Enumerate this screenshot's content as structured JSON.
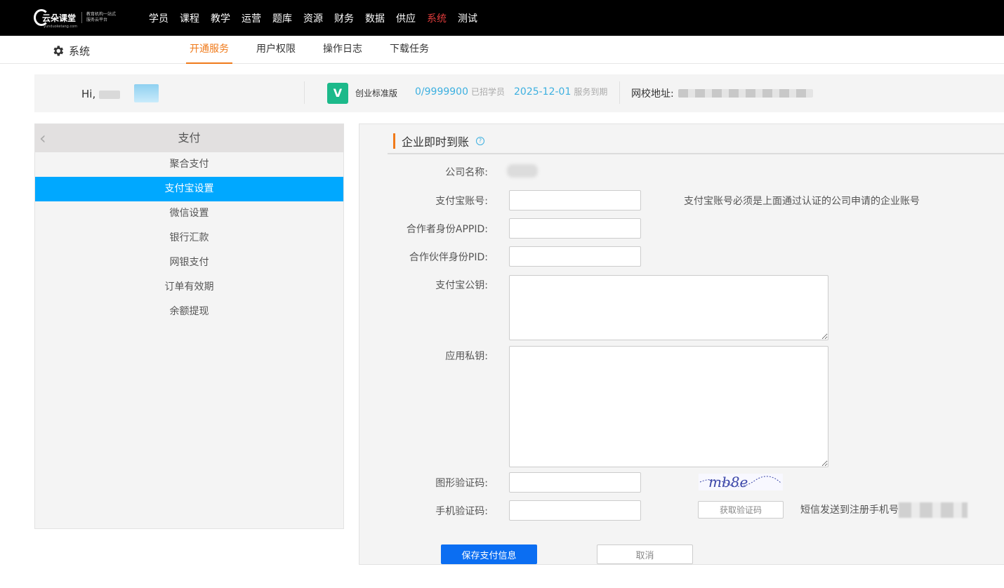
{
  "topbar": {
    "logo": {
      "name": "云朵课堂",
      "domain": "yunduoketang.com",
      "slogan": "教育机构一站式服务云平台"
    },
    "nav": [
      "学员",
      "课程",
      "教学",
      "运营",
      "题库",
      "资源",
      "财务",
      "数据",
      "供应",
      "系统",
      "测试"
    ],
    "active_nav": "系统"
  },
  "subbar": {
    "title": "系统",
    "tabs": [
      "开通服务",
      "用户权限",
      "操作日志",
      "下载任务"
    ],
    "active_tab": "开通服务"
  },
  "infobar": {
    "greeting": "Hi,",
    "version_badge": "V",
    "version_name": "创业标准版",
    "student_count": "0/9999900",
    "student_label": "已招学员",
    "expire_date": "2025-12-01",
    "expire_label": "服务到期",
    "school_label": "网校地址:"
  },
  "sidebar": {
    "title": "支付",
    "items": [
      "聚合支付",
      "支付宝设置",
      "微信设置",
      "银行汇款",
      "网银支付",
      "订单有效期",
      "余额提现"
    ],
    "active_item": "支付宝设置"
  },
  "form": {
    "section_title": "企业即时到账",
    "labels": {
      "company": "公司名称:",
      "alipay_account": "支付宝账号:",
      "appid": "合作者身份APPID:",
      "pid": "合作伙伴身份PID:",
      "public_key": "支付宝公钥:",
      "private_key": "应用私钥:",
      "captcha": "图形验证码:",
      "sms": "手机验证码:"
    },
    "values": {
      "alipay_account": "",
      "appid": "",
      "pid": "",
      "public_key": "",
      "private_key": "",
      "captcha": "",
      "sms": ""
    },
    "account_hint": "支付宝账号必须是上面通过认证的公司申请的企业账号",
    "captcha_image_text": "mb8e",
    "get_code_button": "获取验证码",
    "sms_hint": "短信发送到注册手机号",
    "save_button": "保存支付信息",
    "cancel_button": "取消"
  },
  "colors": {
    "topbar_bg": "#000000",
    "active_nav": "#e03c3c",
    "active_tab": "#f07a1a",
    "sidebar_active": "#00a8ff",
    "primary_button": "#0b6ef2",
    "info_accent": "#3db0e0",
    "version_badge": "#1cb98a"
  }
}
